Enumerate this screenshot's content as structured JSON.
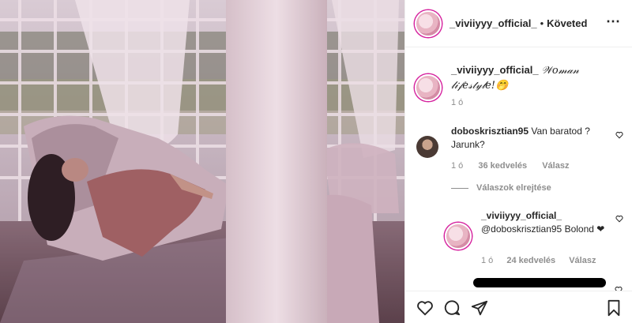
{
  "post": {
    "username": "_viviiyyy_official_",
    "follow_label": "Követed"
  },
  "caption": {
    "username": "_viviiyyy_official_",
    "text": "𝒲𝑜𝓂𝒶𝓃 𝓁𝒾𝒻𝑒𝓈𝓉𝓎𝓁𝑒!🤭",
    "time": "1 ó"
  },
  "comment1": {
    "username": "doboskrisztian95",
    "text": "Van baratod ? Jarunk?",
    "time": "1 ó",
    "likes": "36 kedvelés",
    "reply_label": "Válasz",
    "hide_replies": "Válaszok elrejtése"
  },
  "reply1": {
    "username": "_viviiyyy_official_",
    "text": "@doboskrisztian95 Bolond ❤",
    "time": "1 ó",
    "likes": "24 kedvelés",
    "reply_label": "Válasz"
  },
  "icons": [
    "heart-icon",
    "comment-icon",
    "share-icon",
    "bookmark-icon",
    "more-icon"
  ]
}
